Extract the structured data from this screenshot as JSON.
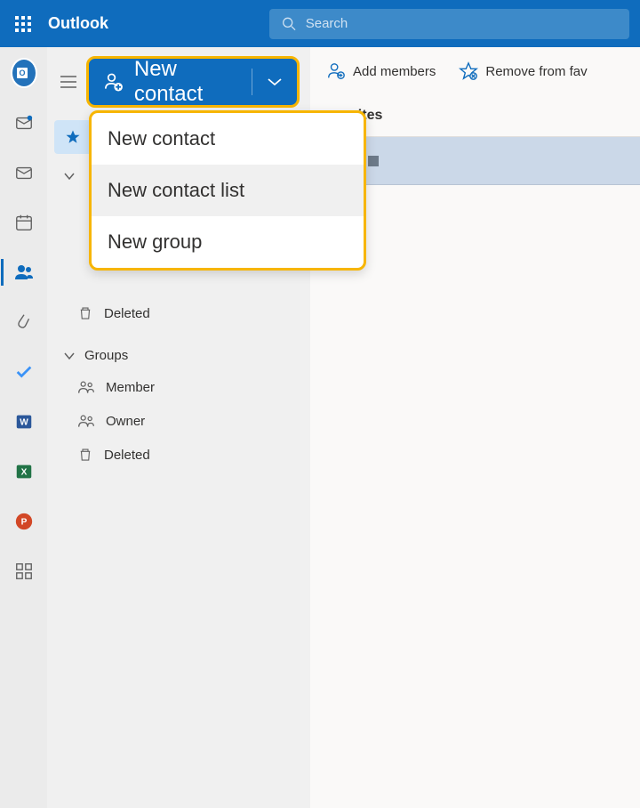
{
  "header": {
    "app_name": "Outlook",
    "search_placeholder": "Search"
  },
  "new_contact_button": {
    "label": "New contact"
  },
  "dropdown": {
    "items": [
      {
        "label": "New contact"
      },
      {
        "label": "New contact list"
      },
      {
        "label": "New group"
      }
    ]
  },
  "sidebar": {
    "favorites_label": "Favorites",
    "contacts_section": {
      "deleted_label": "Deleted"
    },
    "groups_section": {
      "header": "Groups",
      "member_label": "Member",
      "owner_label": "Owner",
      "deleted_label": "Deleted"
    }
  },
  "toolbar": {
    "add_members": "Add members",
    "remove_favorites": "Remove from fav"
  },
  "content": {
    "header_label": "avorites"
  }
}
